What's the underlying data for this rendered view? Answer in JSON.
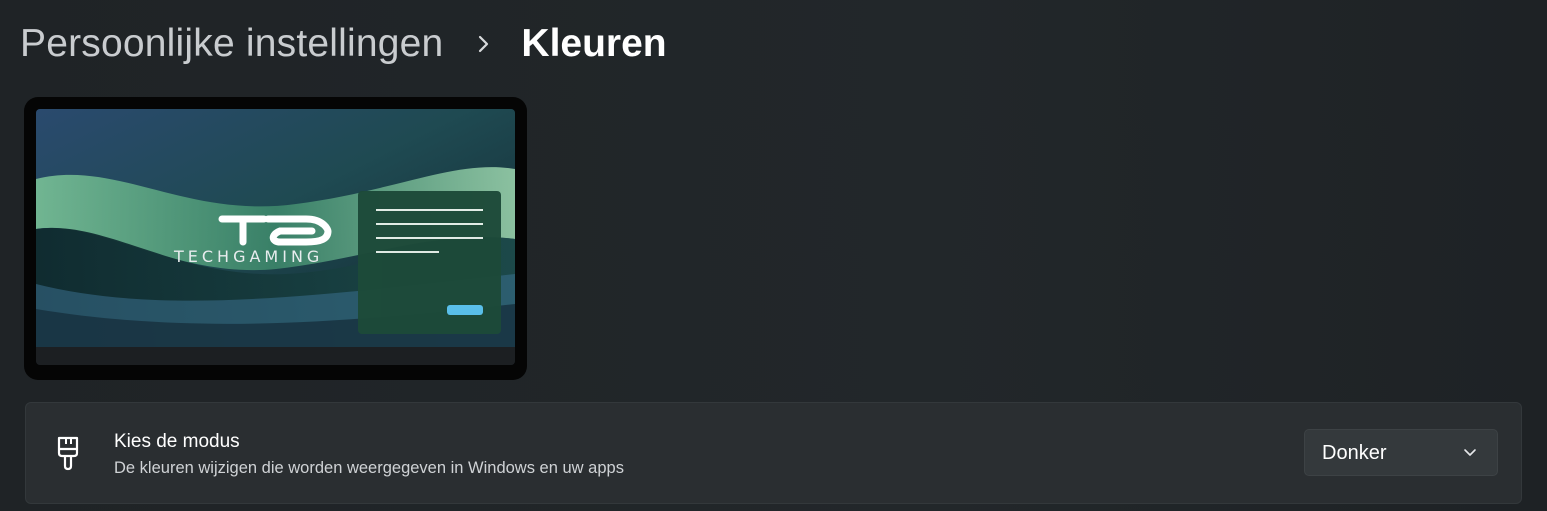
{
  "breadcrumb": {
    "parent": "Persoonlijke instellingen",
    "separator_icon": "chevron-right-icon",
    "current": "Kleuren"
  },
  "preview": {
    "logo_text": "TECHGAMING",
    "logo_monogram": "TG",
    "accent_button_color": "#5cc3ef",
    "window_color": "#1d4a39"
  },
  "mode_setting": {
    "icon": "paintbrush-icon",
    "title": "Kies de modus",
    "description": "De kleuren wijzigen die worden weergegeven in Windows en uw apps",
    "selected_value": "Donker",
    "dropdown_icon": "chevron-down-icon"
  }
}
